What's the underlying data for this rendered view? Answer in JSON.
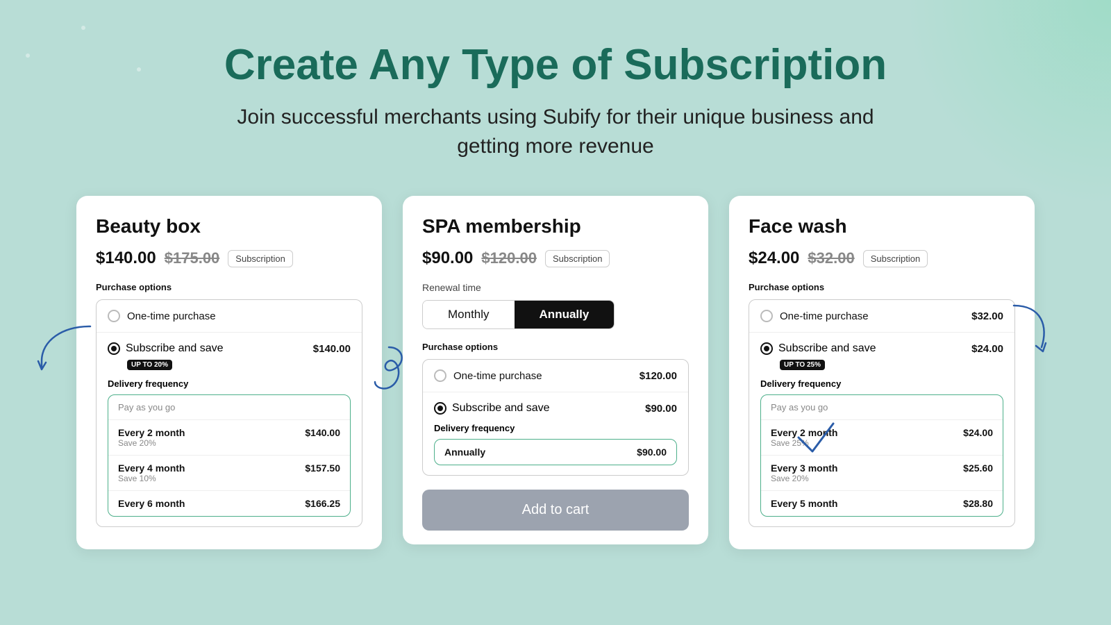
{
  "page": {
    "title": "Create Any Type of Subscription",
    "subtitle_line1": "Join successful merchants using Subify for their unique business and",
    "subtitle_line2": "getting more revenue"
  },
  "cards": [
    {
      "id": "beauty-box",
      "title": "Beauty box",
      "price_current": "$140.00",
      "price_original": "$175.00",
      "badge": "Subscription",
      "purchase_options_label": "Purchase options",
      "options": [
        {
          "type": "one-time",
          "label": "One-time purchase",
          "price": "",
          "selected": false
        },
        {
          "type": "subscribe",
          "label": "Subscribe and save",
          "price": "$140.00",
          "selected": true,
          "up_to_badge": "UP To 20%"
        }
      ],
      "delivery_label": "Delivery frequency",
      "delivery_header": "Pay as you go",
      "delivery_items": [
        {
          "name": "Every 2 month",
          "save": "Save 20%",
          "price": "$140.00"
        },
        {
          "name": "Every 4 month",
          "save": "Save 10%",
          "price": "$157.50"
        },
        {
          "name": "Every 6 month",
          "save": "",
          "price": "$166.25"
        }
      ]
    },
    {
      "id": "spa-membership",
      "title": "SPA membership",
      "price_current": "$90.00",
      "price_original": "$120.00",
      "badge": "Subscription",
      "renewal_label": "Renewal time",
      "toggle_options": [
        "Monthly",
        "Annually"
      ],
      "active_toggle": "Annually",
      "purchase_options_label": "Purchase options",
      "options": [
        {
          "type": "one-time",
          "label": "One-time purchase",
          "price": "$120.00",
          "selected": false
        },
        {
          "type": "subscribe",
          "label": "Subscribe and save",
          "price": "$90.00",
          "selected": true
        }
      ],
      "delivery_label": "Delivery frequency",
      "delivery_items": [
        {
          "name": "Annually",
          "save": "",
          "price": "$90.00"
        }
      ],
      "add_to_cart_label": "Add to cart"
    },
    {
      "id": "face-wash",
      "title": "Face wash",
      "price_current": "$24.00",
      "price_original": "$32.00",
      "badge": "Subscription",
      "purchase_options_label": "Purchase options",
      "options": [
        {
          "type": "one-time",
          "label": "One-time purchase",
          "price": "$32.00",
          "selected": false
        },
        {
          "type": "subscribe",
          "label": "Subscribe and save",
          "price": "$24.00",
          "selected": true,
          "up_to_badge": "UP To 25%"
        }
      ],
      "delivery_label": "Delivery frequency",
      "delivery_header": "Pay as you go",
      "delivery_items": [
        {
          "name": "Every 2 month",
          "save": "Save 25%",
          "price": "$24.00"
        },
        {
          "name": "Every 3 month",
          "save": "Save 20%",
          "price": "$25.60"
        },
        {
          "name": "Every 5 month",
          "save": "",
          "price": "$28.80"
        }
      ]
    }
  ]
}
